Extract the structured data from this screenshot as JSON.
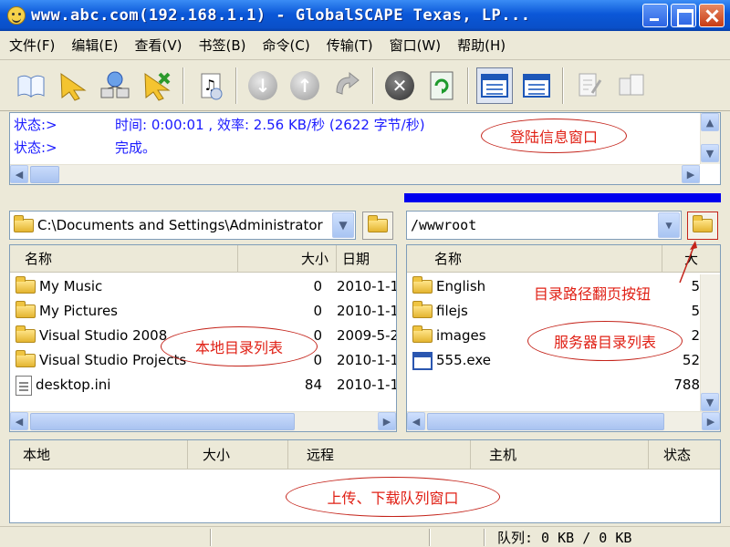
{
  "window": {
    "title": "www.abc.com(192.168.1.1) - GlobalSCAPE Texas, LP..."
  },
  "menu": [
    "文件(F)",
    "编辑(E)",
    "查看(V)",
    "书签(B)",
    "命令(C)",
    "传输(T)",
    "窗口(W)",
    "帮助(H)"
  ],
  "toolbar": {
    "icons": [
      "open-book-icon",
      "connect-arrow-icon",
      "network-icon",
      "disconnect-arrow-icon",
      "music-file-icon",
      "download-icon",
      "upload-icon",
      "refresh-transfer-icon",
      "stop-icon",
      "refresh-icon",
      "local-view-icon",
      "remote-view-icon",
      "edit-icon",
      "view-icon"
    ]
  },
  "log": {
    "lines": [
      {
        "label": "状态:>",
        "text": "时间: 0:00:01 , 效率: 2.56 KB/秒 (2622 字节/秒)"
      },
      {
        "label": "状态:>",
        "text": "完成。"
      }
    ]
  },
  "local": {
    "path": "C:\\Documents and Settings\\Administrator",
    "columns": [
      "名称",
      "大小",
      "日期"
    ],
    "rows": [
      {
        "name": "My Music",
        "size": "0",
        "date": "2010-1-1",
        "icon": "music-folder-icon"
      },
      {
        "name": "My Pictures",
        "size": "0",
        "date": "2010-1-1",
        "icon": "picture-folder-icon"
      },
      {
        "name": "Visual Studio 2008",
        "size": "0",
        "date": "2009-5-2",
        "icon": "folder-icon"
      },
      {
        "name": "Visual Studio Projects",
        "size": "0",
        "date": "2010-1-1",
        "icon": "folder-icon"
      },
      {
        "name": "desktop.ini",
        "size": "84",
        "date": "2010-1-1",
        "icon": "file-icon"
      }
    ]
  },
  "remote": {
    "path": "/wwwroot",
    "columns": [
      "名称",
      "大"
    ],
    "rows": [
      {
        "name": "English",
        "size": "5",
        "icon": "folder-icon"
      },
      {
        "name": "filejs",
        "size": "5",
        "icon": "folder-icon"
      },
      {
        "name": "images",
        "size": "2",
        "icon": "folder-icon"
      },
      {
        "name": "555.exe",
        "size": "52",
        "icon": "exe-icon"
      },
      {
        "name": "",
        "size": "788",
        "icon": ""
      }
    ]
  },
  "queue": {
    "columns": [
      "本地",
      "大小",
      "远程",
      "主机",
      "状态"
    ]
  },
  "status": {
    "text": "队列: 0 KB / 0 KB"
  },
  "annotations": {
    "login": "登陆信息窗口",
    "local_list": "本地目录列表",
    "path_button": "目录路径翻页按钮",
    "server_list": "服务器目录列表",
    "queue": "上传、下载队列窗口"
  },
  "colors": {
    "title_blue": "#0b58d8",
    "log_text": "#1a1aff",
    "annotation_red": "#e02015",
    "remote_header": "#0000ee"
  }
}
